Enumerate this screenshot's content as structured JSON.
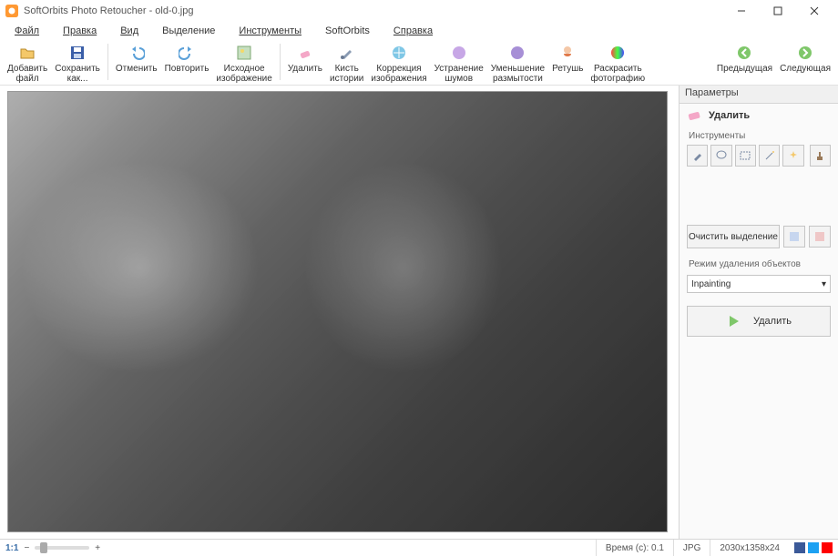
{
  "window": {
    "title": "SoftOrbits Photo Retoucher - old-0.jpg"
  },
  "menu": {
    "file": "Файл",
    "edit": "Правка",
    "view": "Вид",
    "selection": "Выделение",
    "tools": "Инструменты",
    "softorbits": "SoftOrbits",
    "help": "Справка"
  },
  "toolbar": {
    "add_file": "Добавить\nфайл",
    "save_as": "Сохранить\nкак...",
    "undo": "Отменить",
    "redo": "Повторить",
    "original": "Исходное\nизображение",
    "remove": "Удалить",
    "history_brush": "Кисть\nистории",
    "image_correction": "Коррекция\nизображения",
    "noise_removal": "Устранение\nшумов",
    "sharpen": "Уменьшение\nразмытости",
    "retouch": "Ретушь",
    "colorize": "Раскрасить\nфотографию",
    "prev": "Предыдущая",
    "next": "Следующая"
  },
  "sidebar": {
    "panel_title": "Параметры",
    "section": "Удалить",
    "tools_label": "Инструменты",
    "clear_selection": "Очистить выделение",
    "mode_label": "Режим удаления объектов",
    "mode_value": "Inpainting",
    "remove_btn": "Удалить"
  },
  "status": {
    "zoom": "1:1",
    "time_label": "Время (с):",
    "time_value": "0.1",
    "format": "JPG",
    "dims": "2030x1358x24"
  }
}
